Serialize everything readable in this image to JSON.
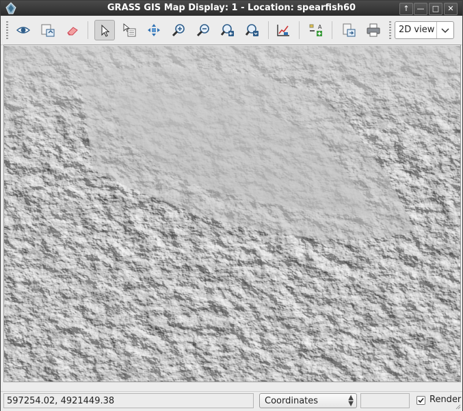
{
  "window": {
    "title": "GRASS GIS Map Display: 1 - Location: spearfish60",
    "controls": [
      "up-arrow",
      "minimize",
      "maximize",
      "close"
    ]
  },
  "toolbar": {
    "buttons": [
      {
        "name": "display-map",
        "icon": "eye-icon"
      },
      {
        "name": "render-map",
        "icon": "render-map-icon"
      },
      {
        "name": "erase-display",
        "icon": "eraser-icon"
      },
      {
        "name": "pointer",
        "icon": "pointer-icon",
        "active": true
      },
      {
        "name": "query",
        "icon": "query-icon"
      },
      {
        "name": "pan",
        "icon": "pan-icon"
      },
      {
        "name": "zoom-in",
        "icon": "zoom-in-icon"
      },
      {
        "name": "zoom-out",
        "icon": "zoom-out-icon"
      },
      {
        "name": "zoom-back",
        "icon": "zoom-back-icon"
      },
      {
        "name": "zoom-menu",
        "icon": "zoom-menu-icon"
      },
      {
        "name": "analyze",
        "icon": "analyze-icon"
      },
      {
        "name": "overlay",
        "icon": "map-overlay-icon"
      },
      {
        "name": "save-file",
        "icon": "save-image-icon"
      },
      {
        "name": "print",
        "icon": "printer-icon"
      }
    ],
    "view_mode": "2D view"
  },
  "map": {
    "description_icon": "shaded-relief-raster"
  },
  "statusbar": {
    "coordinates": "597254.02, 4921449.38",
    "mode": "Coordinates",
    "extra": "",
    "render_label": "Render",
    "render_checked": true
  },
  "colors": {
    "titlebar": "#2b2b2b",
    "window_bg": "#ececec",
    "map_relief": "#c6c6c6"
  }
}
